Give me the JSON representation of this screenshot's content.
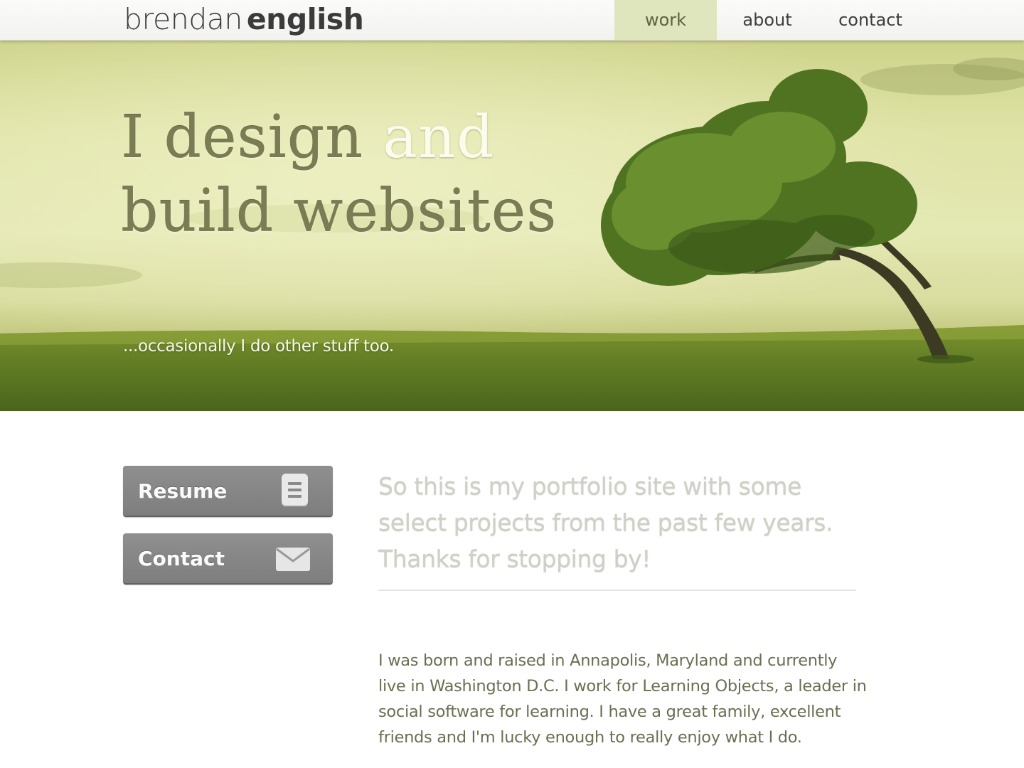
{
  "header": {
    "brand_first": "brendan",
    "brand_last": "english",
    "nav": [
      {
        "label": "work",
        "active": true
      },
      {
        "label": "about",
        "active": false
      },
      {
        "label": "contact",
        "active": false
      }
    ],
    "active_color": "#dfe5bd"
  },
  "hero": {
    "line1_a": "I design",
    "line1_b": "and",
    "line2": "build websites",
    "tagline": "...occasionally I do other stuff too.",
    "image": "tree-on-grassy-hill"
  },
  "sidebar": {
    "resume_label": "Resume",
    "resume_icon": "document-icon",
    "contact_label": "Contact",
    "contact_icon": "envelope-icon",
    "button_color": "#858585"
  },
  "main": {
    "intro": "So this is my portfolio site with some select projects from the past few years. Thanks for stopping by!",
    "bio": "I was born and raised in Annapolis, Maryland and currently live in Washington D.C. I work for Learning Objects, a leader in social software for learning. I have a great family, excellent friends and I'm lucky enough to really enjoy what I do."
  }
}
